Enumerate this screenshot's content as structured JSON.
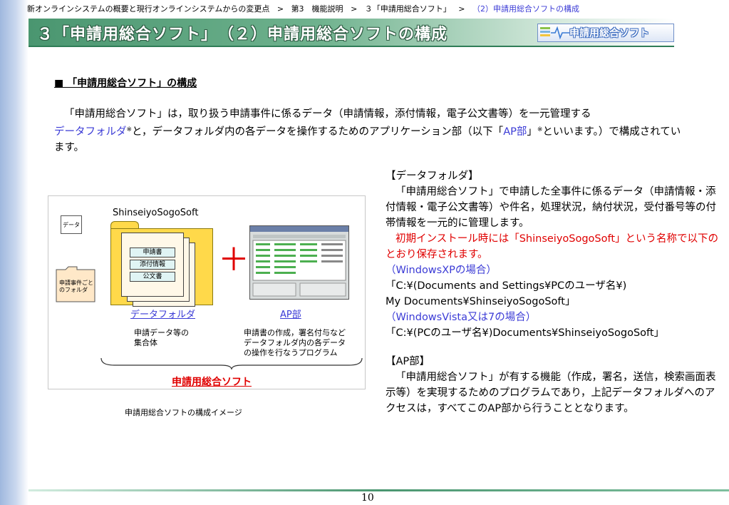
{
  "breadcrumb": {
    "item1": "新オンラインシステムの概要と現行オンラインシステムからの変更点",
    "sep": ">",
    "item2": "第3　機能説明",
    "item3": "３「申請用総合ソフト」",
    "item4": "（2）申請用総合ソフトの構成"
  },
  "title": "３「申請用総合ソフト」　（２）申請用総合ソフトの構成",
  "logo_text": "申請用総合ソフト",
  "section_heading": "■ 「申請用総合ソフト」の構成",
  "intro": {
    "part1": "「申請用総合ソフト」は，取り扱う申請事件に係るデータ（申請情報，添付情報，電子公文書等）を一元管理する",
    "data_folder": "データフォルダ",
    "mark1": "※",
    "part2": "と，データフォルダ内の各データを操作するためのアプリケーション部（以下「",
    "ap": "AP部",
    "part3": "」",
    "mark2": "※",
    "part4": "といいます。）で構成されています。"
  },
  "figure": {
    "software_name": "ShinseiyoSogoSoft",
    "data_icon_label": "データ",
    "folder_icon_label": "申請事件ごとのフォルダ",
    "doc1": "申請書",
    "doc2": "添付情報",
    "doc3": "公文書",
    "plus": "＋",
    "data_folder_label": "データフォルダ",
    "ap_label": "AP部",
    "data_folder_desc_line1": "申請データ等の",
    "data_folder_desc_line2": "集合体",
    "ap_desc_line1": "申請書の作成，署名付与など",
    "ap_desc_line2": "データフォルダ内の各データ",
    "ap_desc_line3": "の操作を行なうプログラム",
    "bracket_label": "申請用総合ソフト",
    "caption": "申請用総合ソフトの構成イメージ"
  },
  "right": {
    "df_heading": "【データフォルダ】",
    "df_text": "「申請用総合ソフト」で申請した全事件に係るデータ（申請情報・添付情報・電子公文書等）や件名，処理状況，納付状況，受付番号等の付帯情報を一元的に管理します。",
    "df_red": "初期インストール時には「ShinseiyoSogoSoft」という名称で以下のとおり保存されます。",
    "xp_heading": "（WindowsXPの場合）",
    "xp_path_line1": "「C:¥(Documents and Settings¥PCのユーザ名¥)",
    "xp_path_line2": "My Documents¥ShinseiyoSogoSoft」",
    "vista_heading": "（WindowsVista又は7の場合）",
    "vista_path": "「C:¥(PCのユーザ名¥)Documents¥ShinseiyoSogoSoft」",
    "ap_heading": "【AP部】",
    "ap_text": "「申請用総合ソフト」が有する機能（作成，署名，送信，検索画面表示等）を実現するためのプログラムであり，上記データフォルダへのアクセスは，すべてこのAP部から行うこととなります。"
  },
  "page_number": "10",
  "colors": {
    "title_band": "#4a9670",
    "accent_blue": "#3b3bd6",
    "accent_red": "#e00000",
    "folder_yellow": "#ffd94a"
  }
}
